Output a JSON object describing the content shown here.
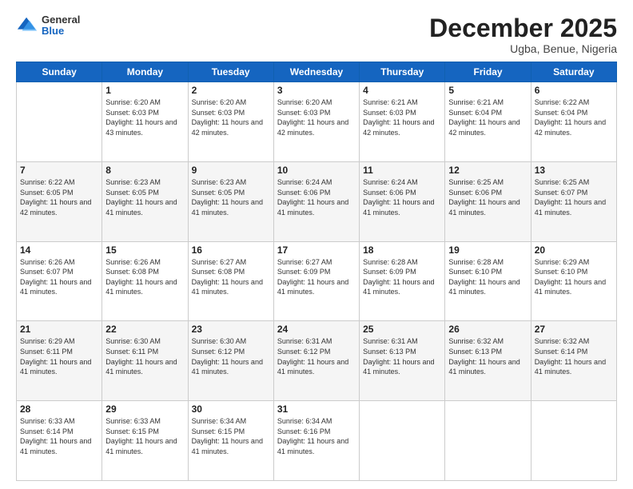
{
  "header": {
    "logo": {
      "general": "General",
      "blue": "Blue"
    },
    "title": "December 2025",
    "location": "Ugba, Benue, Nigeria"
  },
  "weekdays": [
    "Sunday",
    "Monday",
    "Tuesday",
    "Wednesday",
    "Thursday",
    "Friday",
    "Saturday"
  ],
  "weeks": [
    [
      {
        "day": "",
        "sunrise": "",
        "sunset": "",
        "daylight": ""
      },
      {
        "day": "1",
        "sunrise": "Sunrise: 6:20 AM",
        "sunset": "Sunset: 6:03 PM",
        "daylight": "Daylight: 11 hours and 43 minutes."
      },
      {
        "day": "2",
        "sunrise": "Sunrise: 6:20 AM",
        "sunset": "Sunset: 6:03 PM",
        "daylight": "Daylight: 11 hours and 42 minutes."
      },
      {
        "day": "3",
        "sunrise": "Sunrise: 6:20 AM",
        "sunset": "Sunset: 6:03 PM",
        "daylight": "Daylight: 11 hours and 42 minutes."
      },
      {
        "day": "4",
        "sunrise": "Sunrise: 6:21 AM",
        "sunset": "Sunset: 6:03 PM",
        "daylight": "Daylight: 11 hours and 42 minutes."
      },
      {
        "day": "5",
        "sunrise": "Sunrise: 6:21 AM",
        "sunset": "Sunset: 6:04 PM",
        "daylight": "Daylight: 11 hours and 42 minutes."
      },
      {
        "day": "6",
        "sunrise": "Sunrise: 6:22 AM",
        "sunset": "Sunset: 6:04 PM",
        "daylight": "Daylight: 11 hours and 42 minutes."
      }
    ],
    [
      {
        "day": "7",
        "sunrise": "Sunrise: 6:22 AM",
        "sunset": "Sunset: 6:05 PM",
        "daylight": "Daylight: 11 hours and 42 minutes."
      },
      {
        "day": "8",
        "sunrise": "Sunrise: 6:23 AM",
        "sunset": "Sunset: 6:05 PM",
        "daylight": "Daylight: 11 hours and 41 minutes."
      },
      {
        "day": "9",
        "sunrise": "Sunrise: 6:23 AM",
        "sunset": "Sunset: 6:05 PM",
        "daylight": "Daylight: 11 hours and 41 minutes."
      },
      {
        "day": "10",
        "sunrise": "Sunrise: 6:24 AM",
        "sunset": "Sunset: 6:06 PM",
        "daylight": "Daylight: 11 hours and 41 minutes."
      },
      {
        "day": "11",
        "sunrise": "Sunrise: 6:24 AM",
        "sunset": "Sunset: 6:06 PM",
        "daylight": "Daylight: 11 hours and 41 minutes."
      },
      {
        "day": "12",
        "sunrise": "Sunrise: 6:25 AM",
        "sunset": "Sunset: 6:06 PM",
        "daylight": "Daylight: 11 hours and 41 minutes."
      },
      {
        "day": "13",
        "sunrise": "Sunrise: 6:25 AM",
        "sunset": "Sunset: 6:07 PM",
        "daylight": "Daylight: 11 hours and 41 minutes."
      }
    ],
    [
      {
        "day": "14",
        "sunrise": "Sunrise: 6:26 AM",
        "sunset": "Sunset: 6:07 PM",
        "daylight": "Daylight: 11 hours and 41 minutes."
      },
      {
        "day": "15",
        "sunrise": "Sunrise: 6:26 AM",
        "sunset": "Sunset: 6:08 PM",
        "daylight": "Daylight: 11 hours and 41 minutes."
      },
      {
        "day": "16",
        "sunrise": "Sunrise: 6:27 AM",
        "sunset": "Sunset: 6:08 PM",
        "daylight": "Daylight: 11 hours and 41 minutes."
      },
      {
        "day": "17",
        "sunrise": "Sunrise: 6:27 AM",
        "sunset": "Sunset: 6:09 PM",
        "daylight": "Daylight: 11 hours and 41 minutes."
      },
      {
        "day": "18",
        "sunrise": "Sunrise: 6:28 AM",
        "sunset": "Sunset: 6:09 PM",
        "daylight": "Daylight: 11 hours and 41 minutes."
      },
      {
        "day": "19",
        "sunrise": "Sunrise: 6:28 AM",
        "sunset": "Sunset: 6:10 PM",
        "daylight": "Daylight: 11 hours and 41 minutes."
      },
      {
        "day": "20",
        "sunrise": "Sunrise: 6:29 AM",
        "sunset": "Sunset: 6:10 PM",
        "daylight": "Daylight: 11 hours and 41 minutes."
      }
    ],
    [
      {
        "day": "21",
        "sunrise": "Sunrise: 6:29 AM",
        "sunset": "Sunset: 6:11 PM",
        "daylight": "Daylight: 11 hours and 41 minutes."
      },
      {
        "day": "22",
        "sunrise": "Sunrise: 6:30 AM",
        "sunset": "Sunset: 6:11 PM",
        "daylight": "Daylight: 11 hours and 41 minutes."
      },
      {
        "day": "23",
        "sunrise": "Sunrise: 6:30 AM",
        "sunset": "Sunset: 6:12 PM",
        "daylight": "Daylight: 11 hours and 41 minutes."
      },
      {
        "day": "24",
        "sunrise": "Sunrise: 6:31 AM",
        "sunset": "Sunset: 6:12 PM",
        "daylight": "Daylight: 11 hours and 41 minutes."
      },
      {
        "day": "25",
        "sunrise": "Sunrise: 6:31 AM",
        "sunset": "Sunset: 6:13 PM",
        "daylight": "Daylight: 11 hours and 41 minutes."
      },
      {
        "day": "26",
        "sunrise": "Sunrise: 6:32 AM",
        "sunset": "Sunset: 6:13 PM",
        "daylight": "Daylight: 11 hours and 41 minutes."
      },
      {
        "day": "27",
        "sunrise": "Sunrise: 6:32 AM",
        "sunset": "Sunset: 6:14 PM",
        "daylight": "Daylight: 11 hours and 41 minutes."
      }
    ],
    [
      {
        "day": "28",
        "sunrise": "Sunrise: 6:33 AM",
        "sunset": "Sunset: 6:14 PM",
        "daylight": "Daylight: 11 hours and 41 minutes."
      },
      {
        "day": "29",
        "sunrise": "Sunrise: 6:33 AM",
        "sunset": "Sunset: 6:15 PM",
        "daylight": "Daylight: 11 hours and 41 minutes."
      },
      {
        "day": "30",
        "sunrise": "Sunrise: 6:34 AM",
        "sunset": "Sunset: 6:15 PM",
        "daylight": "Daylight: 11 hours and 41 minutes."
      },
      {
        "day": "31",
        "sunrise": "Sunrise: 6:34 AM",
        "sunset": "Sunset: 6:16 PM",
        "daylight": "Daylight: 11 hours and 41 minutes."
      },
      {
        "day": "",
        "sunrise": "",
        "sunset": "",
        "daylight": ""
      },
      {
        "day": "",
        "sunrise": "",
        "sunset": "",
        "daylight": ""
      },
      {
        "day": "",
        "sunrise": "",
        "sunset": "",
        "daylight": ""
      }
    ]
  ]
}
